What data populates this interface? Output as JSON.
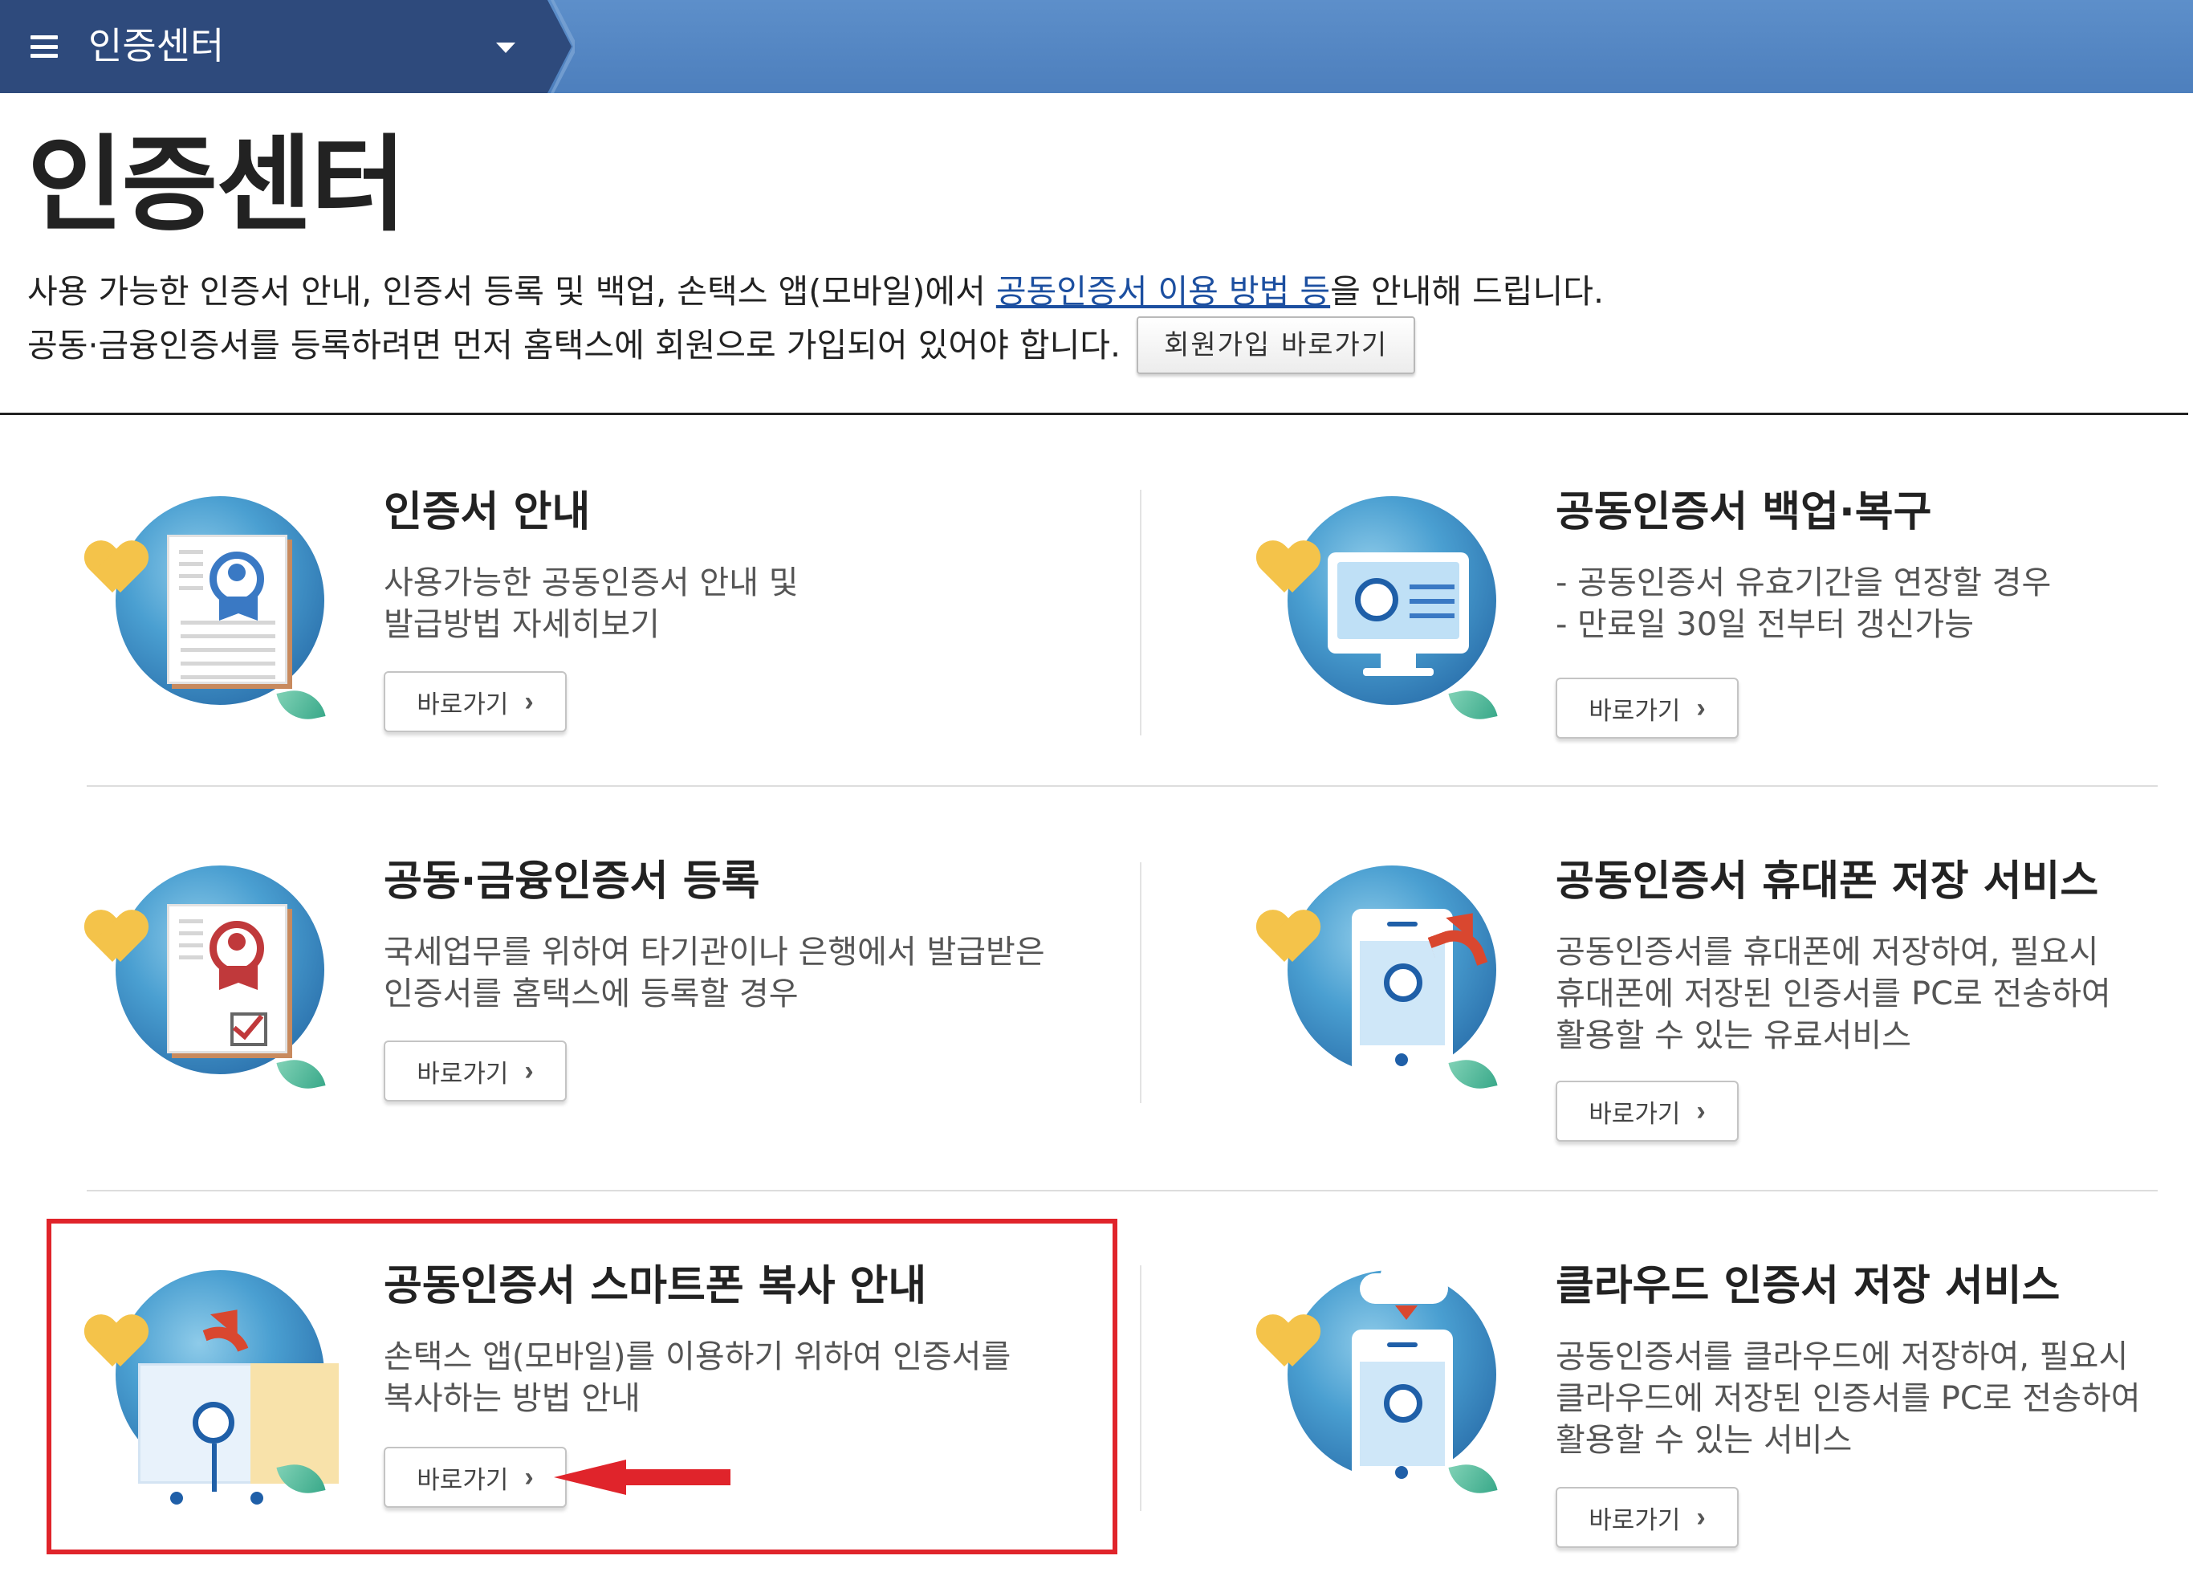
{
  "topbar": {
    "menu_title": "인증센터"
  },
  "page": {
    "title": "인증센터",
    "intro_line1_prefix": "사용 가능한 인증서 안내, 인증서 등록 및 백업, 손택스 앱(모바일)에서 ",
    "intro_line1_link": "공동인증서 이용 방법 등",
    "intro_line1_suffix": "을 안내해 드립니다.",
    "intro_line2": "공동·금융인증서를 등록하려면 먼저 홈택스에 회원으로 가입되어 있어야 합니다.",
    "signup_button": "회원가입 바로가기"
  },
  "cards": [
    {
      "title": "인증서 안내",
      "desc": "사용가능한 공동인증서 안내 및\n발급방법 자세히보기",
      "button": "바로가기"
    },
    {
      "title": "공동인증서 백업·복구",
      "desc": "- 공동인증서 유효기간을 연장할 경우\n- 만료일 30일 전부터 갱신가능",
      "button": "바로가기"
    },
    {
      "title": "공동·금융인증서 등록",
      "desc": "국세업무를 위하여 타기관이나 은행에서 발급받은\n인증서를 홈택스에 등록할 경우",
      "button": "바로가기"
    },
    {
      "title": "공동인증서 휴대폰 저장 서비스",
      "desc": "공동인증서를 휴대폰에 저장하여, 필요시\n휴대폰에 저장된 인증서를 PC로 전송하여\n활용할 수 있는 유료서비스",
      "button": "바로가기"
    },
    {
      "title": "공동인증서 스마트폰 복사 안내",
      "desc": "손택스 앱(모바일)를 이용하기 위하여 인증서를\n복사하는 방법 안내",
      "button": "바로가기"
    },
    {
      "title": "클라우드 인증서 저장 서비스",
      "desc": "공동인증서를 클라우드에 저장하여, 필요시\n클라우드에 저장된 인증서를 PC로 전송하여\n활용할 수 있는 서비스",
      "button": "바로가기"
    }
  ],
  "icons": {
    "chevron": "›",
    "menu": "hamburger-icon",
    "dropdown": "caret-down-icon"
  },
  "colors": {
    "topbar": "#4d7fbd",
    "menu_bg": "#2e4a7c",
    "link": "#1c4fa0",
    "annotation": "#e0242b"
  }
}
